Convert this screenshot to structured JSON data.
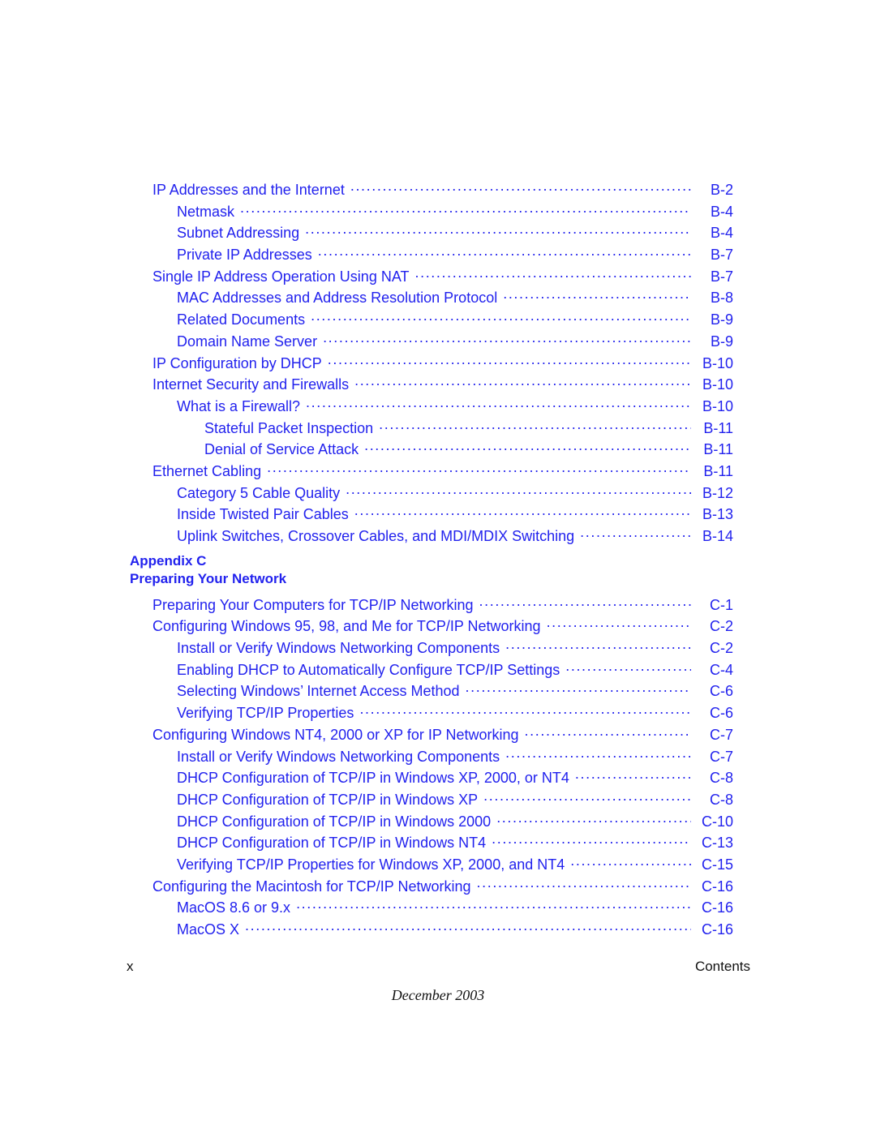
{
  "document": {
    "footer": {
      "page_number": "x",
      "section_label": "Contents",
      "date": "December 2003"
    },
    "appendix_heading": {
      "line1": "Appendix C",
      "line2": "Preparing Your Network"
    }
  },
  "toc": {
    "entries": [
      {
        "level": 0,
        "title": "IP Addresses and the Internet",
        "page": "B-2"
      },
      {
        "level": 1,
        "title": "Netmask",
        "page": "B-4"
      },
      {
        "level": 1,
        "title": "Subnet Addressing",
        "page": "B-4"
      },
      {
        "level": 1,
        "title": "Private IP Addresses",
        "page": "B-7"
      },
      {
        "level": 0,
        "title": "Single IP Address Operation Using NAT",
        "page": "B-7"
      },
      {
        "level": 1,
        "title": "MAC Addresses and Address Resolution Protocol",
        "page": "B-8"
      },
      {
        "level": 1,
        "title": "Related Documents",
        "page": "B-9"
      },
      {
        "level": 1,
        "title": "Domain Name Server",
        "page": "B-9"
      },
      {
        "level": 0,
        "title": "IP Configuration by DHCP",
        "page": "B-10"
      },
      {
        "level": 0,
        "title": "Internet Security and Firewalls",
        "page": "B-10"
      },
      {
        "level": 1,
        "title": "What is a Firewall?",
        "page": "B-10"
      },
      {
        "level": 2,
        "title": "Stateful Packet Inspection",
        "page": "B-11"
      },
      {
        "level": 2,
        "title": "Denial of Service Attack",
        "page": "B-11"
      },
      {
        "level": 0,
        "title": "Ethernet Cabling",
        "page": "B-11"
      },
      {
        "level": 1,
        "title": "Category 5 Cable Quality",
        "page": "B-12"
      },
      {
        "level": 1,
        "title": "Inside Twisted Pair Cables",
        "page": "B-13"
      },
      {
        "level": 1,
        "title": "Uplink Switches, Crossover Cables, and MDI/MDIX Switching",
        "page": "B-14"
      }
    ],
    "entries_appendix_c": [
      {
        "level": 0,
        "title": "Preparing Your Computers for TCP/IP Networking",
        "page": "C-1"
      },
      {
        "level": 0,
        "title": "Configuring Windows 95, 98, and Me for TCP/IP Networking",
        "page": "C-2"
      },
      {
        "level": 1,
        "title": "Install or Verify Windows Networking Components",
        "page": "C-2"
      },
      {
        "level": 1,
        "title": "Enabling DHCP to Automatically Configure TCP/IP Settings",
        "page": "C-4"
      },
      {
        "level": 1,
        "title": "Selecting Windows’ Internet Access Method",
        "page": "C-6"
      },
      {
        "level": 1,
        "title": "Verifying TCP/IP Properties",
        "page": "C-6"
      },
      {
        "level": 0,
        "title": "Configuring Windows NT4, 2000 or XP for IP Networking",
        "page": "C-7"
      },
      {
        "level": 1,
        "title": "Install or Verify Windows Networking Components",
        "page": "C-7"
      },
      {
        "level": 1,
        "title": "DHCP Configuration of TCP/IP in Windows XP, 2000, or NT4",
        "page": "C-8"
      },
      {
        "level": 1,
        "title": "DHCP Configuration of TCP/IP in Windows XP",
        "page": "C-8"
      },
      {
        "level": 1,
        "title": "DHCP Configuration of TCP/IP in Windows 2000",
        "page": "C-10"
      },
      {
        "level": 1,
        "title": "DHCP Configuration of TCP/IP in Windows NT4",
        "page": "C-13"
      },
      {
        "level": 1,
        "title": "Verifying TCP/IP Properties for Windows XP, 2000, and NT4",
        "page": "C-15"
      },
      {
        "level": 0,
        "title": "Configuring the Macintosh for TCP/IP Networking",
        "page": "C-16"
      },
      {
        "level": 1,
        "title": "MacOS 8.6 or 9.x",
        "page": "C-16"
      },
      {
        "level": 1,
        "title": "MacOS X",
        "page": "C-16"
      }
    ]
  },
  "colors": {
    "toc_text": "#2222ee",
    "footer_text": "#111111",
    "background": "#ffffff"
  }
}
